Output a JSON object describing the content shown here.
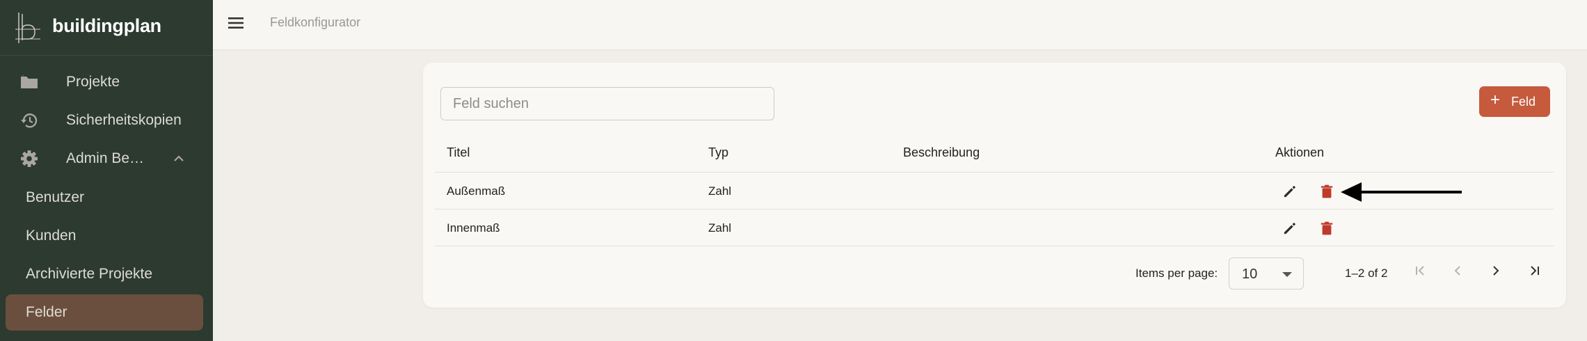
{
  "brand": {
    "name": "buildingplan"
  },
  "sidebar": {
    "items": [
      {
        "label": "Projekte",
        "icon": "folder-icon"
      },
      {
        "label": "Sicherheitskopien",
        "icon": "restore-icon"
      },
      {
        "label": "Admin Be…",
        "icon": "gear-icon",
        "expanded": true
      }
    ],
    "subitems": [
      {
        "label": "Benutzer"
      },
      {
        "label": "Kunden"
      },
      {
        "label": "Archivierte Projekte"
      },
      {
        "label": "Felder",
        "active": true
      }
    ]
  },
  "header": {
    "title": "Feldkonfigurator"
  },
  "search": {
    "placeholder": "Feld suchen",
    "value": ""
  },
  "add_button": {
    "label": "Feld"
  },
  "table": {
    "columns": [
      "Titel",
      "Typ",
      "Beschreibung",
      "Aktionen"
    ],
    "rows": [
      {
        "title": "Außenmaß",
        "type": "Zahl",
        "description": ""
      },
      {
        "title": "Innenmaß",
        "type": "Zahl",
        "description": ""
      }
    ]
  },
  "pagination": {
    "items_per_page_label": "Items per page:",
    "items_per_page": "10",
    "range": "1–2 of 2"
  },
  "colors": {
    "sidebar_bg": "#2c3a2f",
    "active_item_bg": "#6a4f3f",
    "accent": "#c65a3c",
    "delete_red": "#c0392b",
    "background": "#f1eee9"
  }
}
